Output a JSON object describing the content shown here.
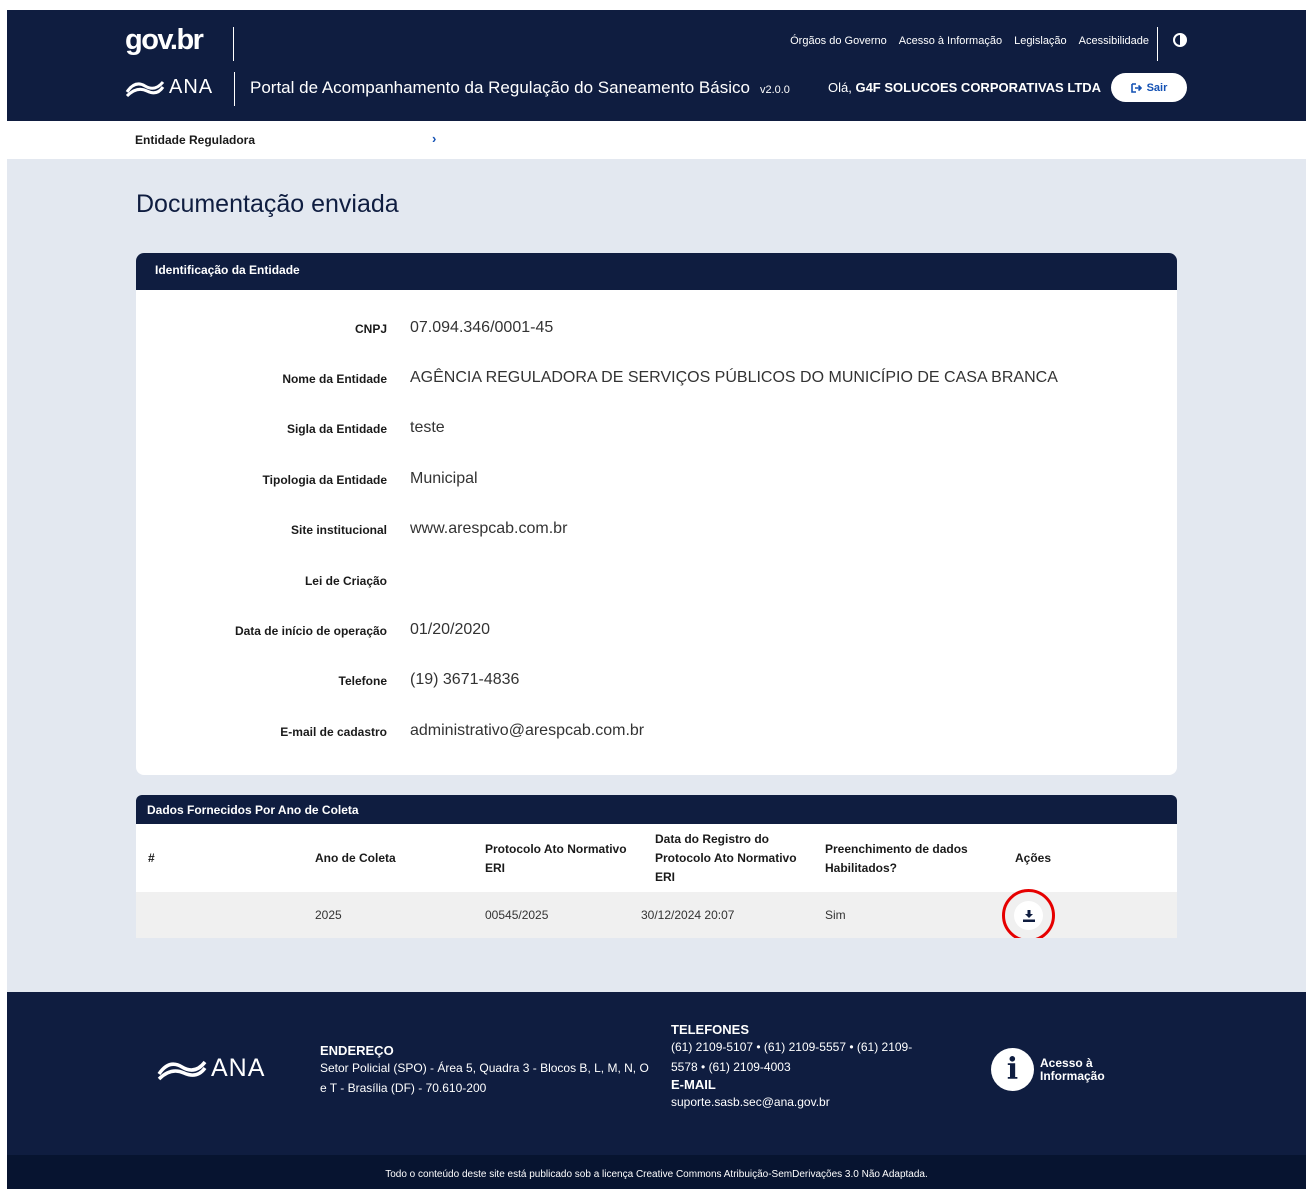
{
  "header": {
    "govbr_logo": "gov.br",
    "top_links": [
      "Órgãos do Governo",
      "Acesso à Informação",
      "Legislação",
      "Acessibilidade"
    ],
    "agency_logo": "ANA",
    "portal_title": "Portal de Acompanhamento da Regulação do Saneamento Básico",
    "version": "v2.0.0",
    "greeting_prefix": "Olá,",
    "user_name": "G4F SOLUCOES CORPORATIVAS LTDA",
    "logout_label": "Sair"
  },
  "breadcrumb": {
    "label": "Entidade Reguladora",
    "chevron": "›"
  },
  "page_title": "Documentação enviada",
  "entity_card": {
    "title": "Identificação da Entidade",
    "fields": [
      {
        "label": "CNPJ",
        "value": "07.094.346/0001-45"
      },
      {
        "label": "Nome da Entidade",
        "value": "AGÊNCIA REGULADORA DE SERVIÇOS PÚBLICOS DO MUNICÍPIO DE CASA BRANCA"
      },
      {
        "label": "Sigla da Entidade",
        "value": "teste"
      },
      {
        "label": "Tipologia da Entidade",
        "value": "Municipal"
      },
      {
        "label": "Site institucional",
        "value": "www.arespcab.com.br"
      },
      {
        "label": "Lei de Criação",
        "value": ""
      },
      {
        "label": "Data de início de operação",
        "value": "01/20/2020"
      },
      {
        "label": "Telefone",
        "value": "(19) 3671-4836"
      },
      {
        "label": "E-mail de cadastro",
        "value": "administrativo@arespcab.com.br"
      }
    ]
  },
  "data_table": {
    "title": "Dados Fornecidos Por Ano de Coleta",
    "columns": [
      "#",
      "Ano de Coleta",
      "Protocolo Ato Normativo ERI",
      "Data do Registro do Protocolo Ato Normativo ERI",
      "Preenchimento de dados Habilitados?",
      "Ações"
    ],
    "rows": [
      {
        "num": "",
        "ano": "2025",
        "protocolo": "00545/2025",
        "data": "30/12/2024 20:07",
        "habilitado": "Sim",
        "action_icon": "download-icon"
      }
    ]
  },
  "footer": {
    "logo": "ANA",
    "address_title": "ENDEREÇO",
    "address": "Setor Policial (SPO) - Área 5, Quadra 3 - Blocos B, L, M, N, O e T - Brasília (DF) - 70.610-200",
    "phones_title": "TELEFONES",
    "phones": "(61) 2109-5107 • (61) 2109-5557 • (61) 2109-5578 • (61) 2109-4003",
    "email_title": "E-MAIL",
    "email": "suporte.sasb.sec@ana.gov.br",
    "info_label": "Acesso à Informação",
    "license": "Todo o conteúdo deste site está publicado sob a licença Creative Commons Atribuição-SemDerivações 3.0 Não Adaptada."
  },
  "colors": {
    "navy": "#0f1d40",
    "page_bg": "#e3e8f0",
    "link_blue": "#1351b4",
    "highlight_red": "#e60000"
  }
}
